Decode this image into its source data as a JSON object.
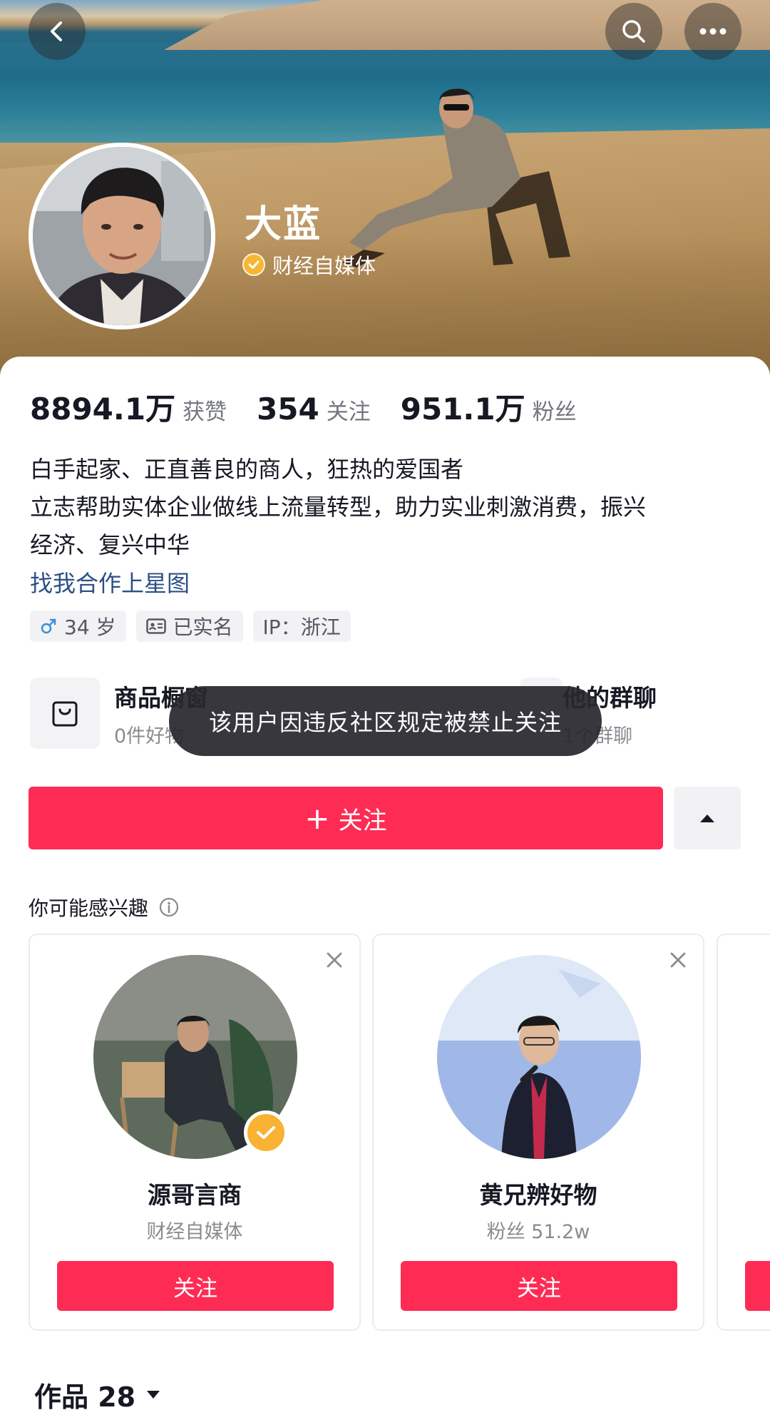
{
  "profile": {
    "name": "大蓝",
    "verified_label": "财经自媒体"
  },
  "stats": [
    {
      "value": "8894.1万",
      "label": "获赞"
    },
    {
      "value": "354",
      "label": "关注"
    },
    {
      "value": "951.1万",
      "label": "粉丝"
    }
  ],
  "bio": {
    "line1": "白手起家、正直善良的商人，狂热的爱国者",
    "line2": "立志帮助实体企业做线上流量转型，助力实业刺激消费，振兴",
    "line3": "经济、复兴中华",
    "link": "找我合作上星图"
  },
  "tags": {
    "age": "34 岁",
    "realname": "已实名",
    "ip": "IP：浙江"
  },
  "features": {
    "products_title": "商品橱窗",
    "products_sub": "0件好物",
    "groups_title": "他的群聊",
    "groups_sub": "1个群聊"
  },
  "toast": "该用户因违反社区规定被禁止关注",
  "follow_button": {
    "plus": "+",
    "label": "关注"
  },
  "recommend": {
    "title": "你可能感兴趣",
    "cards": [
      {
        "name": "源哥言商",
        "sub": "财经自媒体",
        "button": "关注"
      },
      {
        "name": "黄兄辨好物",
        "sub": "粉丝 51.2w",
        "button": "关注"
      }
    ]
  },
  "works": {
    "label": "作品 28"
  },
  "colors": {
    "accent": "#fe2c55",
    "verify": "#f7b733",
    "link": "#2c4f85",
    "toast_bg": "#28282e"
  },
  "icons": {
    "back": "chevron-left-icon",
    "search": "search-icon",
    "more": "more-dots-icon",
    "verify": "check-badge-icon",
    "male": "male-icon",
    "id_card": "id-card-icon",
    "shop": "shopping-bag-icon",
    "expand": "triangle-up-icon",
    "info": "info-icon",
    "close": "close-icon",
    "caret": "caret-down-icon"
  }
}
